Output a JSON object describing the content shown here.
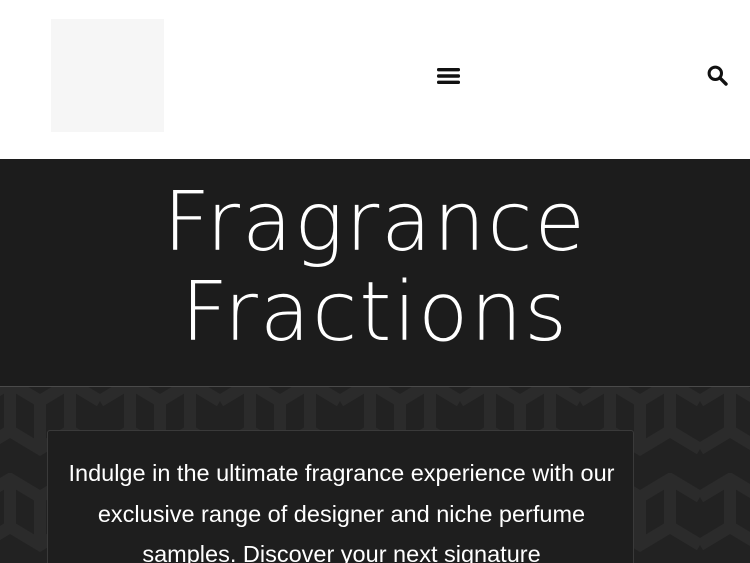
{
  "header": {
    "logo_alt": "",
    "menu_icon": "hamburger-menu-icon",
    "search_icon": "search-icon"
  },
  "hero": {
    "title_line1": "Fragrance",
    "title_line2": "Fractions"
  },
  "intro": {
    "text": "Indulge in the ultimate fragrance experience with our exclusive range of designer and niche perfume samples. Discover your next signature"
  },
  "colors": {
    "header_bg": "#ffffff",
    "hero_bg": "#1c1c1c",
    "pattern_bg": "#222222",
    "text_light": "#ffffff",
    "icon_dark": "#111111"
  }
}
